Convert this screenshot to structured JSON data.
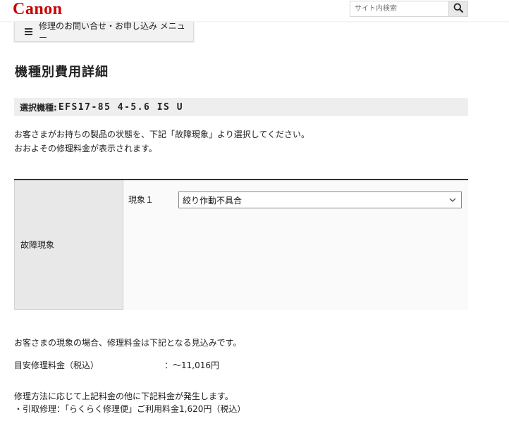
{
  "header": {
    "logo": "Canon",
    "search_placeholder": "サイト内検索"
  },
  "menu": {
    "label": "修理のお問い合せ・お申し込み メニュー"
  },
  "page": {
    "title": "機種別費用詳細"
  },
  "model": {
    "label": "選択機種:",
    "name": "EFS17-85 4-5.6 IS U"
  },
  "intro": {
    "line1": "お客さまがお持ちの製品の状態を、下記「故障現象」より選択してください。",
    "line2": "おおよその修理料金が表示されます。"
  },
  "symptom_table": {
    "header": "故障現象",
    "row_label": "現象１",
    "selected_value": "絞り作動不具合"
  },
  "estimate": {
    "text": "お客さまの現象の場合、修理料金は下記となる見込みです。",
    "fee_label": "目安修理料金（税込）",
    "fee_value": "：～11,016円"
  },
  "notes": {
    "line1": "修理方法に応じて上記料金の他に下記料金が発生します。",
    "line2": "・引取修理：「らくらく修理便」ご利用料金1,620円（税込）"
  },
  "colors": {
    "brand": "#cc0000",
    "model_bar_bg": "#eeeeee",
    "table_header_bg": "#e8e8e8"
  },
  "icons": {
    "search": "search-icon",
    "menu": "hamburger-icon",
    "dropdown": "chevron-down-icon"
  }
}
